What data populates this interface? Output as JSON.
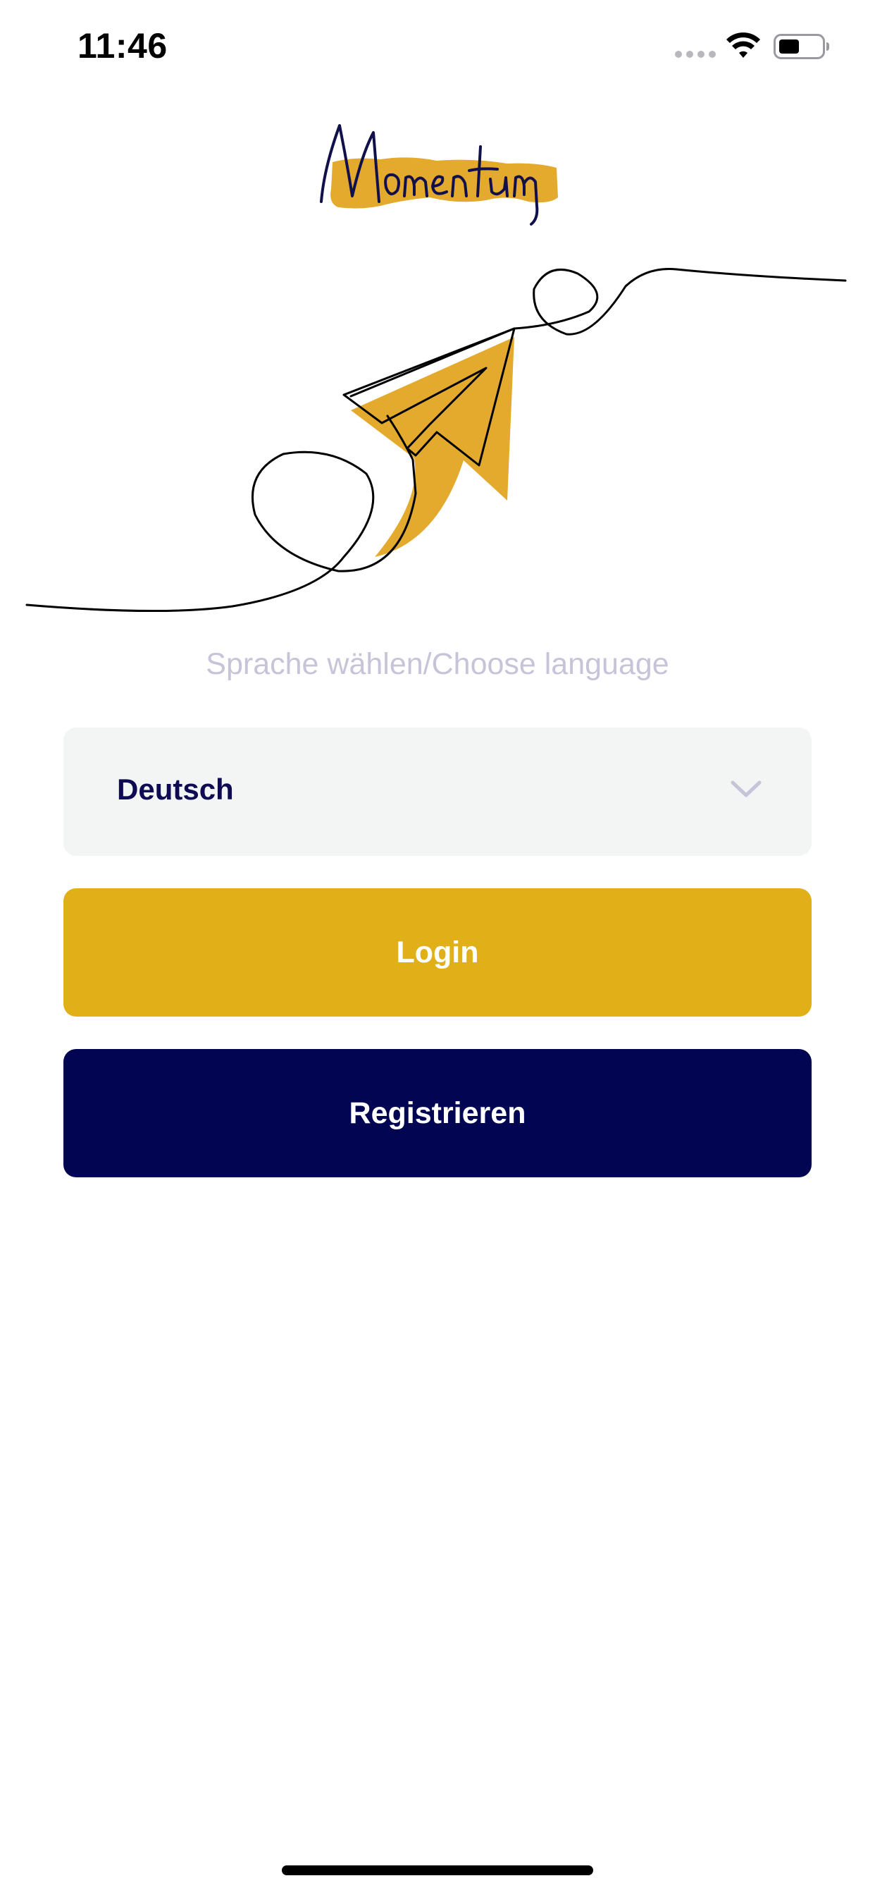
{
  "status_bar": {
    "time": "11:46"
  },
  "logo": {
    "text": "Momentum"
  },
  "language": {
    "prompt": "Sprache wählen/Choose language",
    "selected": "Deutsch"
  },
  "actions": {
    "login_label": "Login",
    "register_label": "Registrieren"
  },
  "colors": {
    "accent_yellow": "#e1b018",
    "brand_navy": "#020552",
    "select_bg": "#f3f4f4",
    "prompt_text": "#c6c4d8"
  },
  "icons": {
    "wifi": "wifi-icon",
    "battery": "battery-icon",
    "chevron": "chevron-down-icon",
    "illustration": "paper-plane-icon"
  }
}
